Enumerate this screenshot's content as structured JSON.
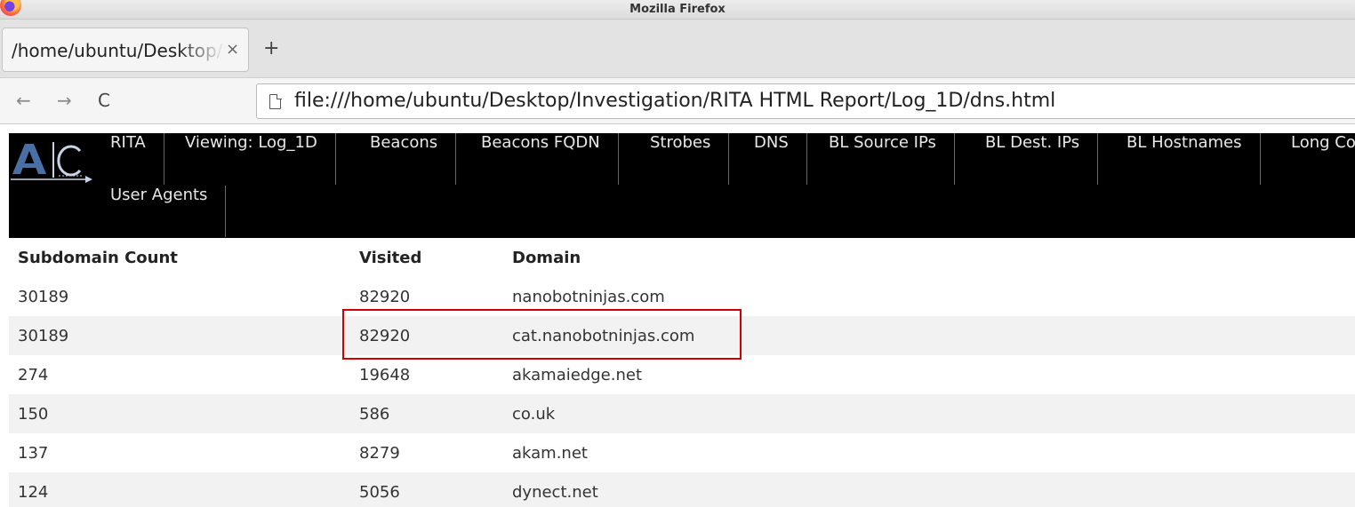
{
  "window": {
    "title": "Mozilla Firefox"
  },
  "browser": {
    "tabs": [
      {
        "label": "/home/ubuntu/Desktop/Investigation",
        "close": "×",
        "active": true
      }
    ],
    "new_tab": "+",
    "nav": {
      "back": "←",
      "forward": "→",
      "reload": "C"
    },
    "url": "file:///home/ubuntu/Desktop/Investigation/RITA HTML Report/Log_1D/dns.html"
  },
  "site_nav": {
    "logo_icon": "rita-ac-logo",
    "items": [
      "RITA",
      "Viewing: Log_1D",
      "Beacons",
      "Beacons FQDN",
      "Strobes",
      "DNS",
      "BL Source IPs",
      "BL Dest. IPs",
      "BL Hostnames",
      "Long Connections",
      "User Agents"
    ]
  },
  "table": {
    "columns": [
      "Subdomain Count",
      "Visited",
      "Domain"
    ],
    "rows": [
      [
        "30189",
        "82920",
        "nanobotninjas.com"
      ],
      [
        "30189",
        "82920",
        "cat.nanobotninjas.com"
      ],
      [
        "274",
        "19648",
        "akamaiedge.net"
      ],
      [
        "150",
        "586",
        "co.uk"
      ],
      [
        "137",
        "8279",
        "akam.net"
      ],
      [
        "124",
        "5056",
        "dynect.net"
      ]
    ]
  },
  "colors": {
    "highlight": "#d00000",
    "nav_background": "#000000",
    "row_shade": "#f2f2f2"
  }
}
